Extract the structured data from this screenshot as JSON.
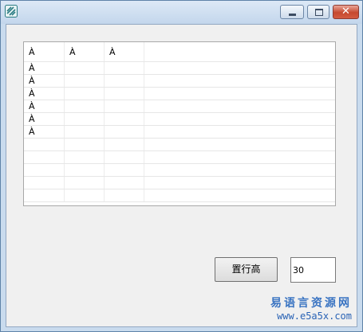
{
  "window": {
    "icon": "app-logo-icon",
    "controls": {
      "minimize": "minimize-icon",
      "maximize": "maximize-icon",
      "close_glyph": "✕"
    }
  },
  "grid": {
    "header": [
      "À",
      "À",
      "À",
      ""
    ],
    "rows": [
      [
        "À",
        "",
        "",
        ""
      ],
      [
        "À",
        "",
        "",
        ""
      ],
      [
        "À",
        "",
        "",
        ""
      ],
      [
        "À",
        "",
        "",
        ""
      ],
      [
        "À",
        "",
        "",
        ""
      ],
      [
        "À",
        "",
        "",
        ""
      ],
      [
        "",
        "",
        "",
        ""
      ],
      [
        "",
        "",
        "",
        ""
      ],
      [
        "",
        "",
        "",
        ""
      ],
      [
        "",
        "",
        "",
        ""
      ],
      [
        "",
        "",
        "",
        ""
      ]
    ]
  },
  "controls": {
    "set_height_label": "置行高",
    "height_value": "30"
  },
  "watermark": {
    "title": "易语言资源网",
    "url": "www.e5a5x.com"
  },
  "colors": {
    "titlebar": "#c9dbee",
    "client_bg": "#f0f0f0",
    "close_button": "#c6492f",
    "watermark": "#3a74c2"
  }
}
